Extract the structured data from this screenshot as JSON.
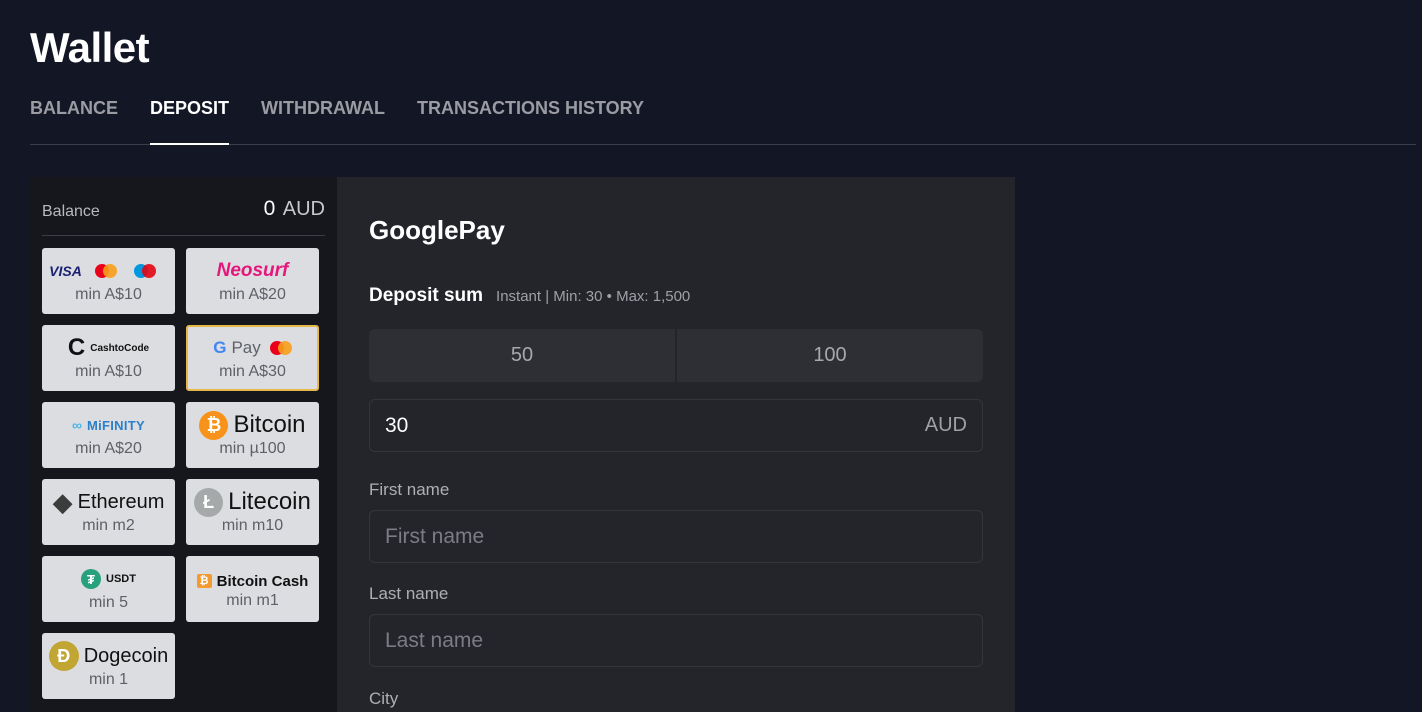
{
  "page": {
    "title": "Wallet"
  },
  "tabs": [
    {
      "label": "BALANCE",
      "active": false
    },
    {
      "label": "DEPOSIT",
      "active": true
    },
    {
      "label": "WITHDRAWAL",
      "active": false
    },
    {
      "label": "TRANSACTIONS HISTORY",
      "active": false
    }
  ],
  "balance": {
    "label": "Balance",
    "amount": "0",
    "currency": "AUD"
  },
  "methods": [
    {
      "name": "Visa / Mastercard / Maestro",
      "logo_text": "VISA",
      "min": "min A$10"
    },
    {
      "name": "Neosurf",
      "logo_text": "Neosurf",
      "min": "min A$20"
    },
    {
      "name": "CashtoCode",
      "logo_text": "CashtoCode",
      "min": "min A$10"
    },
    {
      "name": "GooglePay",
      "logo_text": "Pay",
      "min": "min A$30",
      "selected": true
    },
    {
      "name": "MiFinity",
      "logo_text": "MiFINITY",
      "min": "min A$20"
    },
    {
      "name": "Bitcoin",
      "logo_text": "Bitcoin",
      "min": "min µ100"
    },
    {
      "name": "Ethereum",
      "logo_text": "Ethereum",
      "min": "min m2"
    },
    {
      "name": "Litecoin",
      "logo_text": "Litecoin",
      "min": "min m10"
    },
    {
      "name": "USDT",
      "logo_text": "USDT",
      "min": "min 5"
    },
    {
      "name": "Bitcoin Cash",
      "logo_text": "Bitcoin Cash",
      "min": "min m1"
    },
    {
      "name": "Dogecoin",
      "logo_text": "Dogecoin",
      "min": "min 1"
    }
  ],
  "form": {
    "method_title": "GooglePay",
    "sum_label": "Deposit sum",
    "sum_info": "Instant | Min: 30 • Max: 1,500",
    "quick_amounts": [
      "50",
      "100"
    ],
    "amount_value": "30",
    "amount_currency": "AUD",
    "first_name_label": "First name",
    "first_name_placeholder": "First name",
    "last_name_label": "Last name",
    "last_name_placeholder": "Last name",
    "city_label": "City"
  },
  "colors": {
    "selected_border": "#e6b84a",
    "background": "#131624",
    "panel": "#23252b"
  }
}
